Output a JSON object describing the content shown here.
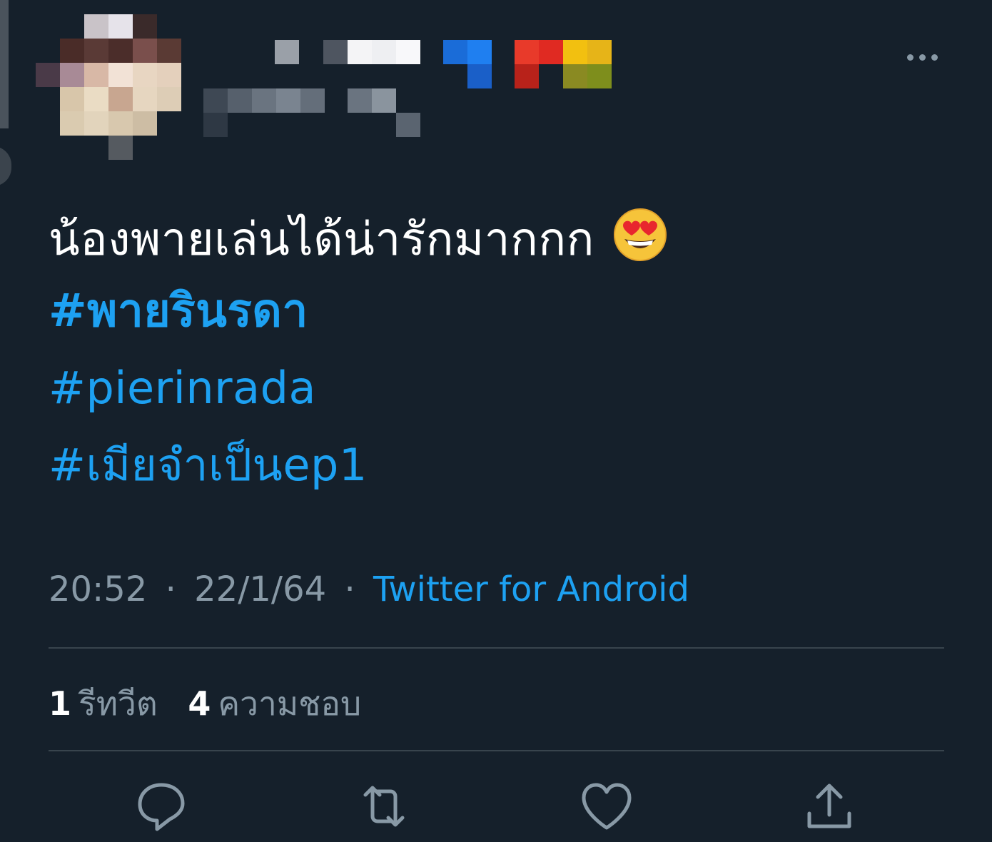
{
  "author": {
    "avatar_icon": "pixelated-avatar",
    "display_name_icon": "pixelated-display-name",
    "handle_icon": "pixelated-handle"
  },
  "tweet": {
    "text": "น้องพายเล่นได้น่ารักมากกก",
    "emoji": "smiling-face-with-heart-eyes",
    "hashtags": [
      "#พายรินรดา",
      "#pierinrada",
      "#เมียจำเป็นep1"
    ]
  },
  "meta": {
    "time": "20:52",
    "separator": "·",
    "date": "22/1/64",
    "source": "Twitter for Android"
  },
  "stats": {
    "retweets_count": "1",
    "retweets_label": "รีทวีต",
    "likes_count": "4",
    "likes_label": "ความชอบ"
  },
  "actions": {
    "reply_icon": "reply-icon",
    "retweet_icon": "retweet-icon",
    "like_icon": "heart-icon",
    "share_icon": "share-icon"
  },
  "colors": {
    "background": "#15202b",
    "text": "#ffffff",
    "secondary": "#8899a6",
    "accent": "#1da1f2",
    "divider": "#38444d"
  }
}
